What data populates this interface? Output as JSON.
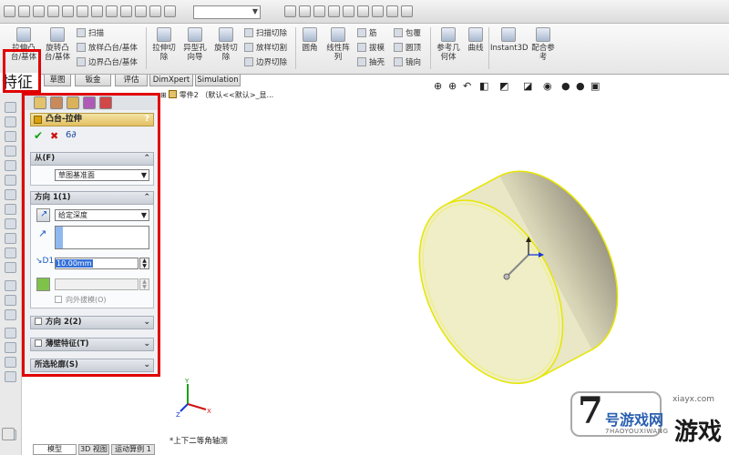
{
  "ribbon": {
    "extrude_boss": "拉伸凸\n台/基体",
    "revolve_boss": "旋转凸\n台/基体",
    "sweep": "扫描",
    "loft_boss": "放样凸台/基体",
    "boundary_boss": "边界凸台/基体",
    "extrude_cut": "拉伸切\n除",
    "hole_wizard": "异型孔\n向导",
    "revolve_cut": "旋转切\n除",
    "swept_cut": "扫描切除",
    "lofted_cut": "放样切割",
    "boundary_cut": "边界切除",
    "fillet": "圆角",
    "linear_pattern": "线性阵\n列",
    "rib": "筋",
    "draft": "拔模",
    "shell": "抽壳",
    "wrap": "包覆",
    "dome": "圆顶",
    "mirror": "镜向",
    "ref_geometry": "参考几\n何体",
    "curves": "曲线",
    "instant3d": "Instant3D",
    "mate_ref": "配合参\n考"
  },
  "tabs": {
    "features": "特征",
    "sketch": "草图",
    "sheet_metal": "钣金",
    "evaluate": "评估",
    "dimxpert": "DimXpert",
    "simulation": "Simulation"
  },
  "tree": {
    "root_label": "零件2 （默认<<默认>_显..."
  },
  "panel": {
    "title": "凸台-拉伸",
    "help": "?",
    "ok": "✔",
    "cancel": "✖",
    "preview": "6∂",
    "from": {
      "label": "从(F)",
      "value": "草图基准面"
    },
    "dir1": {
      "label": "方向 1(1)",
      "end_condition": "给定深度",
      "depth": "10.00mm",
      "draft_outward": "向外拔模(O)"
    },
    "dir2": {
      "label": "方向 2(2)"
    },
    "thin": {
      "label": "薄壁特征(T)"
    },
    "contours": {
      "label": "所选轮廓(S)"
    }
  },
  "view": {
    "orientation_label": "*上下二等角轴测"
  },
  "bottom_tabs": {
    "model": "模型",
    "view3d": "3D 视图",
    "motion": "运动算例 1"
  },
  "watermark": {
    "logo_digit": "7",
    "brand_big": "游戏",
    "brand_top": "号游戏网",
    "brand_en": "7HAOYOUXIWANG",
    "url": "xiayx.com"
  },
  "colors": {
    "highlight_red": "#e00000",
    "disk_fill": "#efeec6",
    "disk_edge": "#e6e600"
  }
}
